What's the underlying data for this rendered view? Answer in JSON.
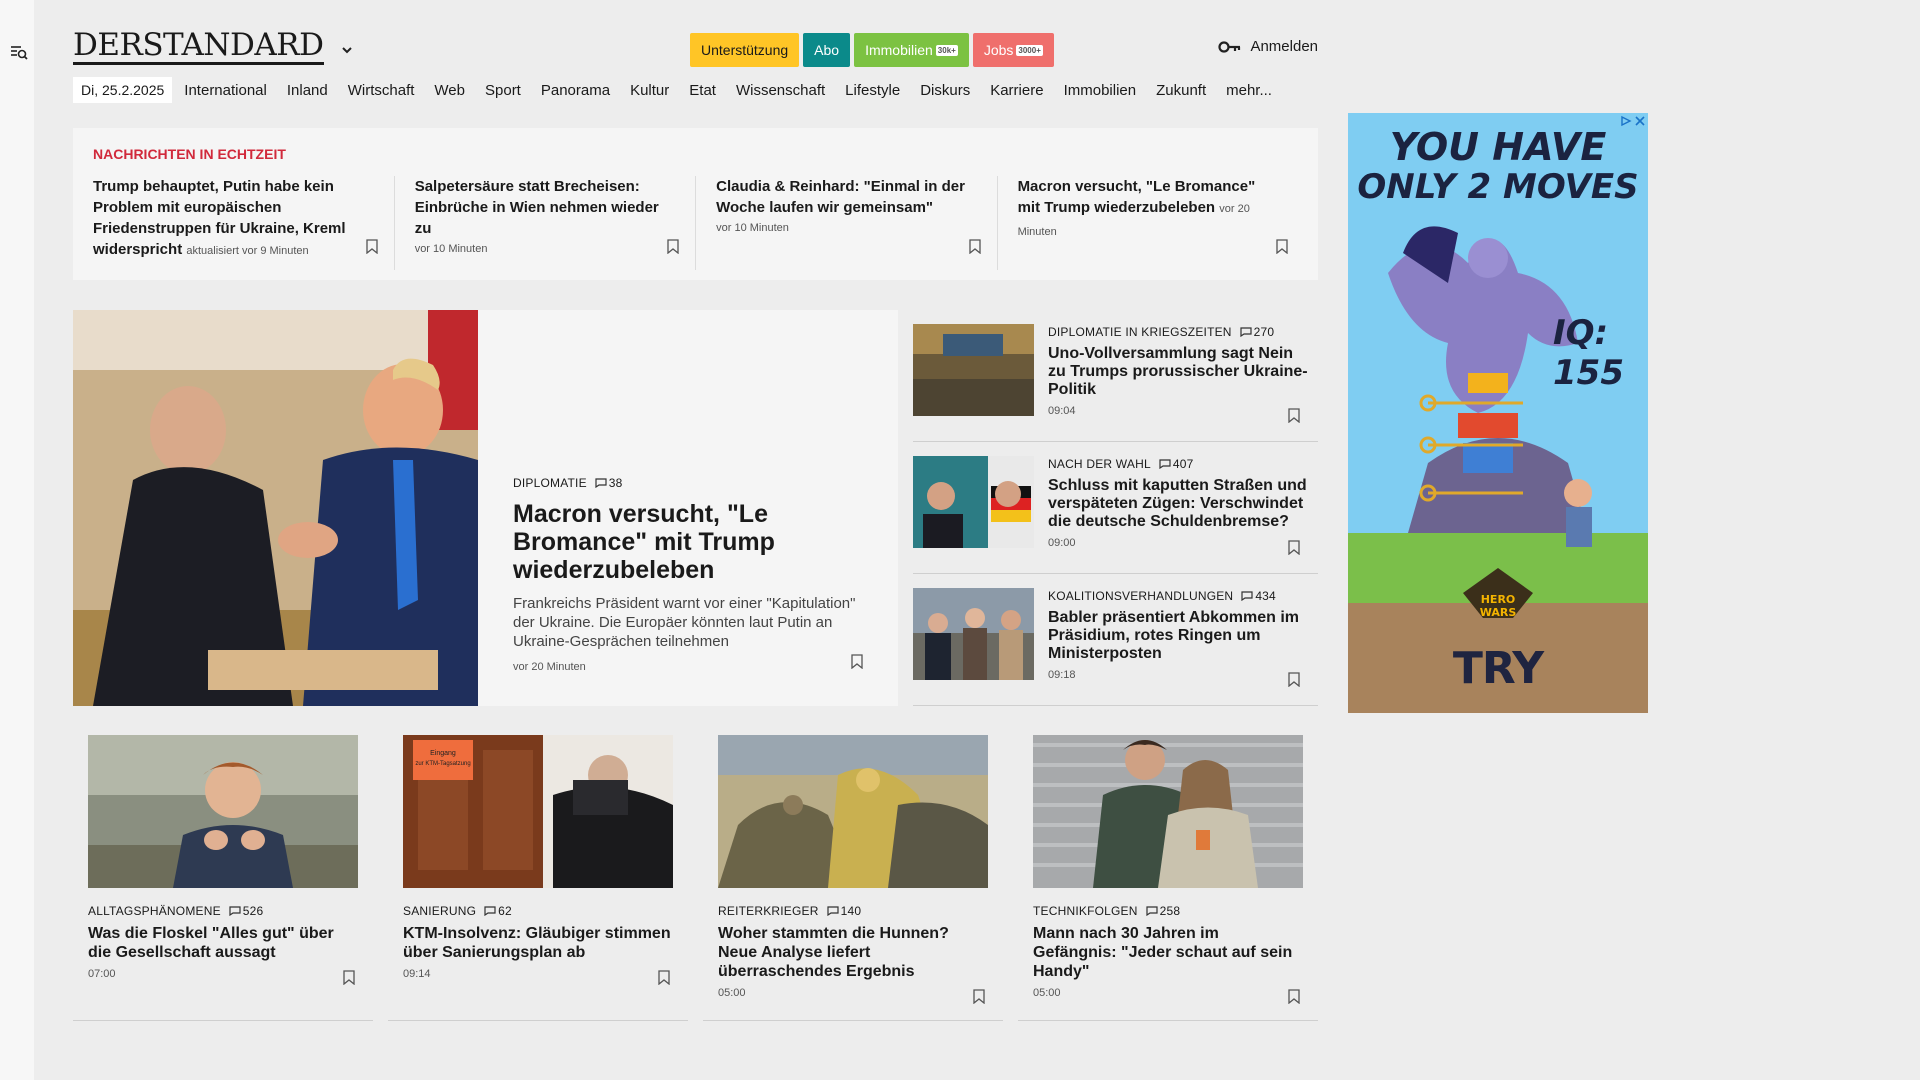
{
  "header": {
    "logo": "DERSTANDARD",
    "chips": {
      "support": "Unterstützung",
      "abo": "Abo",
      "immobilien": "Immobilien",
      "immobilien_badge": "30k+",
      "jobs": "Jobs",
      "jobs_badge": "3000+"
    },
    "login": "Anmelden"
  },
  "nav": {
    "date": "Di, 25.2.2025",
    "items": [
      "International",
      "Inland",
      "Wirtschaft",
      "Web",
      "Sport",
      "Panorama",
      "Kultur",
      "Etat",
      "Wissenschaft",
      "Lifestyle",
      "Diskurs",
      "Karriere",
      "Immobilien",
      "Zukunft",
      "mehr..."
    ]
  },
  "ticker": {
    "title": "NACHRICHTEN IN ECHTZEIT",
    "items": [
      {
        "headline": "Trump behauptet, Putin habe kein Problem mit europäischen Friedenstruppen für Ukraine, Kreml widerspricht",
        "time": "aktualisiert vor 9 Minuten"
      },
      {
        "headline": "Salpetersäure statt Brecheisen: Einbrüche in Wien nehmen wieder zu",
        "time": "vor 10 Minuten"
      },
      {
        "headline": "Claudia & Reinhard: \"Einmal in der Woche laufen wir gemeinsam\"",
        "time": "vor 10 Minuten"
      },
      {
        "headline": "Macron versucht, \"Le Bromance\" mit Trump wiederzubeleben",
        "time": "vor 20 Minuten"
      }
    ]
  },
  "hero": {
    "kicker": "DIPLOMATIE",
    "comments": "38",
    "headline": "Macron versucht, \"Le Bromance\" mit Trump wiederzubeleben",
    "subtitle": "Frankreichs Präsident warnt vor einer \"Kapitulation\" der Ukraine. Die Europäer könnten laut Putin an Ukraine-Gesprächen teilnehmen",
    "time": "vor 20 Minuten"
  },
  "side": [
    {
      "kicker": "DIPLOMATIE IN KRIEGSZEITEN",
      "comments": "270",
      "headline": "Uno-Vollversammlung sagt Nein zu Trumps prorussischer Ukraine-Politik",
      "time": "09:04"
    },
    {
      "kicker": "NACH DER WAHL",
      "comments": "407",
      "headline": "Schluss mit kaputten Straßen und verspäteten Zügen: Verschwindet die deutsche Schuldenbremse?",
      "time": "09:00"
    },
    {
      "kicker": "KOALITIONSVERHANDLUNGEN",
      "comments": "434",
      "headline": "Babler präsentiert Abkommen im Präsidium, rotes Ringen um Ministerposten",
      "time": "09:18"
    }
  ],
  "cards": [
    {
      "kicker": "ALLTAGSPHÄNOMENE",
      "comments": "526",
      "headline": "Was die Floskel \"Alles gut\" über die Gesellschaft aussagt",
      "time": "07:00"
    },
    {
      "kicker": "SANIERUNG",
      "comments": "62",
      "headline": "KTM-Insolvenz: Gläubiger stimmen über Sanierungsplan ab",
      "time": "09:14",
      "sign_text": "Eingang zur KTM-Tagsatzung"
    },
    {
      "kicker": "REITERKRIEGER",
      "comments": "140",
      "headline": "Woher stammten die Hunnen? Neue Analyse liefert überraschendes Ergebnis",
      "time": "05:00"
    },
    {
      "kicker": "TECHNIKFOLGEN",
      "comments": "258",
      "headline": "Mann nach 30 Jahren im Gefängnis: \"Jeder schaut auf sein Handy\"",
      "time": "05:00"
    }
  ],
  "ad": {
    "line1": "YOU HAVE",
    "line2": "ONLY 2 MOVES",
    "iq": "IQ: 155",
    "brand": "HERO WARS",
    "cta": "TRY"
  },
  "colors": {
    "ticker_title": "#d1293b",
    "support": "#ffc526",
    "abo": "#0b8a8a",
    "immobilien": "#7cc242",
    "jobs": "#ef6f6c"
  }
}
